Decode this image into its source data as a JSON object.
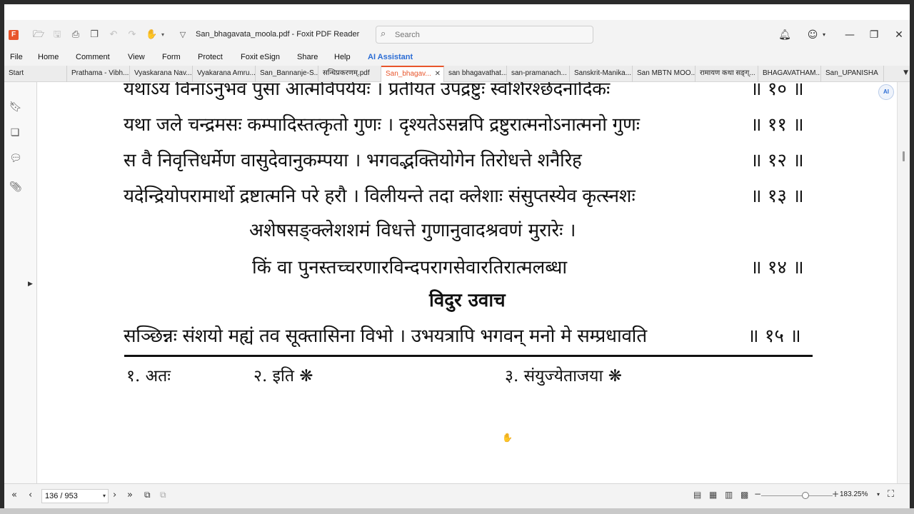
{
  "app": {
    "window_title": "San_bhagavata_moola.pdf - Foxit PDF Reader",
    "logo_glyph": "F"
  },
  "search": {
    "placeholder": "Search"
  },
  "quick_access": {
    "icons": [
      "open-folder-icon",
      "save-icon",
      "print-icon",
      "scan-icon",
      "undo-icon",
      "redo-icon",
      "hand-tool-icon",
      "dropdown-icon"
    ]
  },
  "menu": {
    "items": [
      "File",
      "Home",
      "Comment",
      "View",
      "Form",
      "Protect",
      "Foxit eSign",
      "Share",
      "Help",
      "AI Assistant"
    ]
  },
  "tabs": [
    "Start",
    "Prathama - Vibh...",
    "Vyaskarana Nav...",
    "Vyakarana Amru...",
    "San_Bannanje-S...",
    "सन्धिप्रकरणम्.pdf",
    "San_bhagav...",
    "san bhagavathat...",
    "san-pramanach...",
    "Sanskrit-Manika...",
    "San MBTN MOO...",
    "रामायण कथा सङ्ग्...",
    "BHAGAVATHAM...",
    "San_UPANISHA"
  ],
  "active_tab_index": 6,
  "document": {
    "partial_top_line": "यथाऽयं विनाऽनुभव पुंसां आत्मविपर्ययः । प्रतीयत उपद्रष्टुः स्वशिरश्छेदनादिकः",
    "partial_top_num": "॥ १० ॥",
    "verses": [
      {
        "text": "यथा जले चन्द्रमसः कम्पादिस्तत्कृतो गुणः । दृश्यतेऽसन्नपि द्रष्टुरात्मनोऽनात्मनो गुणः",
        "num": "॥ ११ ॥"
      },
      {
        "text": "स वै निवृत्तिधर्मेण वासुदेवानुकम्पया । भगवद्भक्तियोगेन तिरोधत्ते शनैरिह",
        "num": "॥ १२ ॥"
      },
      {
        "text": "यदेन्द्रियोपरामार्थो द्रष्टात्मनि परे हरौ । विलीयन्ते तदा क्लेशाः संसुप्तस्येव कृत्स्नशः",
        "num": "॥ १३ ॥"
      }
    ],
    "verse14_line1": "अशेषसङ्क्लेशशमं विधत्ते गुणानुवादश्रवणं मुरारेः ।",
    "verse14_line2": "किं वा पुनस्तच्चरणारविन्दपरागसेवारतिरात्मलब्धा",
    "verse14_num": "॥ १४ ॥",
    "heading": "विदुर उवाच",
    "verse15": {
      "text": "सञ्छिन्नः संशयो मह्यं तव सूक्तासिना विभो । उभयत्रापि भगवन् मनो मे सम्प्रधावति",
      "num": "॥ १५ ॥"
    },
    "footnotes": [
      "१. अतः",
      "२. इति ❋",
      "३. संयुज्येताजया ❋"
    ]
  },
  "status": {
    "page_indicator": "136 / 953",
    "zoom_level": "183.25%",
    "zoom_fraction": 0.62
  }
}
